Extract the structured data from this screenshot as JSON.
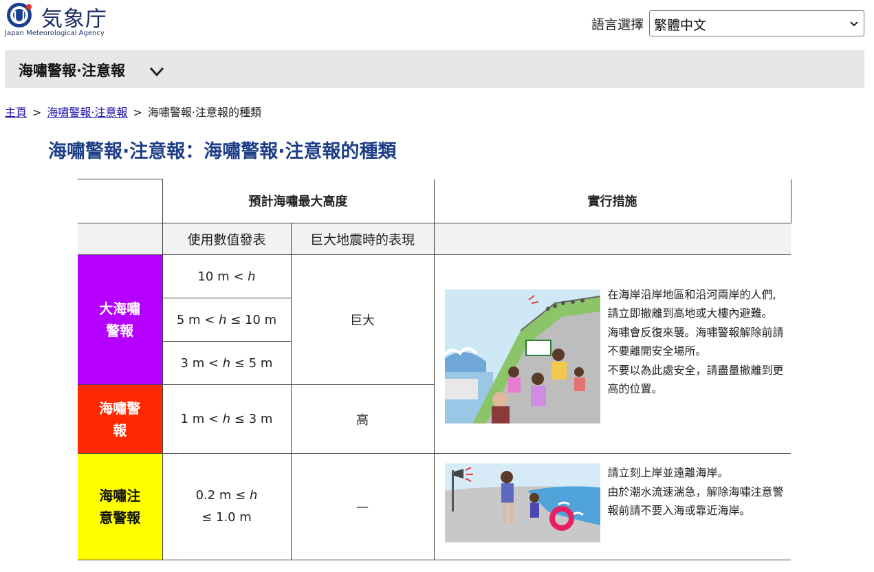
{
  "header": {
    "logo_title": "気象庁",
    "logo_subtitle": "Japan Meteorological Agency",
    "language_label": "語言選擇",
    "language_selected": "繁體中文"
  },
  "section": {
    "title": "海嘯警報·注意報"
  },
  "breadcrumb": {
    "home": "主頁",
    "parent": "海嘯警報·注意報",
    "current": "海嘯警報·注意報的種類",
    "separator": ">"
  },
  "page_title": "海嘯警報·注意報：海嘯警報·注意報的種類",
  "table": {
    "header_height": "預計海嘯最大高度",
    "header_action": "實行措施",
    "sub_numeric": "使用數值發表",
    "sub_quake": "巨大地震時的表現",
    "levels": {
      "major_line1": "大海嘯",
      "major_line2": "警報",
      "warning_line1": "海嘯警",
      "warning_line2": "報",
      "advisory_line1": "海嘯注",
      "advisory_line2": "意警報"
    },
    "heights": {
      "r1_pre": "10 m < ",
      "r1_var": "h",
      "r2_pre": "5 m < ",
      "r2_var": "h",
      "r2_post": " ≤ 10 m",
      "r3_pre": "3 m < ",
      "r3_var": "h",
      "r3_post": " ≤ 5 m",
      "r4_pre": "1 m < ",
      "r4_var": "h",
      "r4_post": " ≤ 3 m",
      "r5_pre": "0.2 m ≤ ",
      "r5_var": "h",
      "r5_line2": "≤ 1.0 m"
    },
    "quake_expr": {
      "huge": "巨大",
      "high": "高",
      "none": "—"
    },
    "actions": {
      "warning": [
        "在海岸沿岸地區和沿河兩岸的人們,",
        "請立即撤離到高地或大樓內避難。",
        "海嘯會反復來襲。海嘯警報解除前請",
        "不要離開安全場所。",
        "不要以為此處安全，請盡量撤離到更",
        "高的位置。"
      ],
      "advisory": [
        "請立刻上岸並遠離海岸。",
        "由於潮水流速湍急，解除海嘯注意警",
        "報前請不要入海或靠近海岸。"
      ]
    }
  },
  "colors": {
    "major_warning": "#b600ff",
    "warning": "#ff2800",
    "advisory": "#ffff00",
    "title_blue": "#1e3f87",
    "link": "#1a0dab"
  },
  "icons": [
    "jma-logo-icon",
    "chevron-down-icon",
    "select-arrow-icon",
    "evacuation-illustration",
    "beach-illustration"
  ]
}
